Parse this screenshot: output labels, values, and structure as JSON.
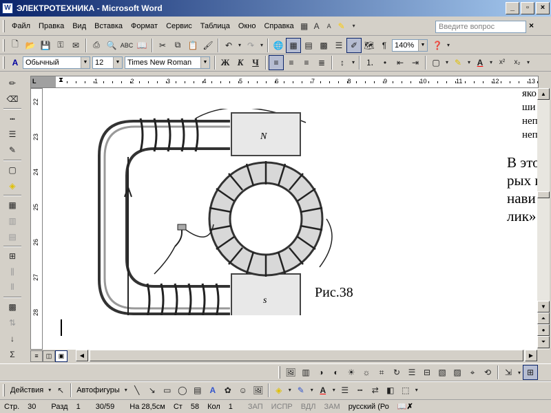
{
  "window": {
    "title": "ЭЛЕКТРОТЕХНИКА - Microsoft Word",
    "minimize": "_",
    "maximize": "▫",
    "close": "×"
  },
  "menu": {
    "items": [
      "Файл",
      "Правка",
      "Вид",
      "Вставка",
      "Формат",
      "Сервис",
      "Таблица",
      "Окно",
      "Справка"
    ],
    "ask_placeholder": "Введите вопрос",
    "ask_close": "×"
  },
  "standard_toolbar": {
    "zoom": "140%",
    "pilcrow": "¶"
  },
  "format_toolbar": {
    "style": "Обычный",
    "size": "12",
    "font": "Times New Roman",
    "bold": "Ж",
    "italic": "К",
    "underline": "Ч",
    "superscript": "x²",
    "subscript": "x₂"
  },
  "ruler": {
    "h_numbers": [
      "1",
      "2",
      "3",
      "4",
      "5",
      "6",
      "7",
      "8",
      "9",
      "10",
      "11",
      "12",
      "13"
    ],
    "v_numbers": [
      "22",
      "23",
      "24",
      "25",
      "26",
      "27",
      "28"
    ]
  },
  "document": {
    "caption": "Рис.38",
    "pole_n": "N",
    "pole_s": "s",
    "right_small_lines": [
      "яко",
      "ши",
      "неп",
      "неп"
    ],
    "right_big_lines": [
      "В это",
      "рых п",
      "нави",
      "лик»"
    ]
  },
  "drawing_toolbar": {
    "actions": "Действия",
    "autoshapes": "Автофигуры"
  },
  "status": {
    "page": "Стр.",
    "page_num": "30",
    "section": "Разд",
    "section_num": "1",
    "pages": "30/59",
    "at": "На 28,5см",
    "line": "Ст",
    "line_num": "58",
    "col": "Кол",
    "col_num": "1",
    "rec": "ЗАП",
    "trk": "ИСПР",
    "ext": "ВДЛ",
    "ovr": "ЗАМ",
    "lang": "русский (Ро"
  },
  "colors": {
    "title_start": "#0a246a",
    "title_end": "#a6caf0",
    "chrome": "#d4d0c8",
    "highlight": "#ffff00",
    "font_color": "#ff0000"
  }
}
